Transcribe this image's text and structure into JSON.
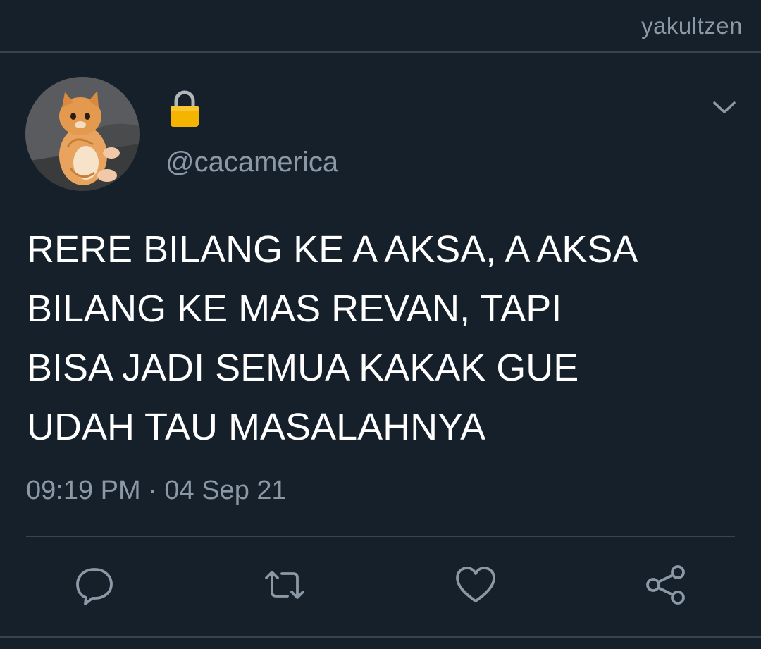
{
  "watermark": "yakultzen",
  "tweet": {
    "lock_icon": "lock-icon",
    "username": "@cacamerica",
    "text": "RERE BILANG KE A AKSA, A AKSA\nBILANG KE MAS REVAN, TAPI\nBISA JADI SEMUA KAKAK GUE\nUDAH TAU MASALAHNYA",
    "timestamp": "09:19 PM · 04 Sep 21"
  },
  "actions": [
    {
      "icon": "reply-icon"
    },
    {
      "icon": "retweet-icon"
    },
    {
      "icon": "like-icon"
    },
    {
      "icon": "share-icon"
    }
  ],
  "colors": {
    "background": "#15202b",
    "secondary_text": "#8b98a5",
    "divider": "#38444d",
    "lock": "#f5b400"
  }
}
